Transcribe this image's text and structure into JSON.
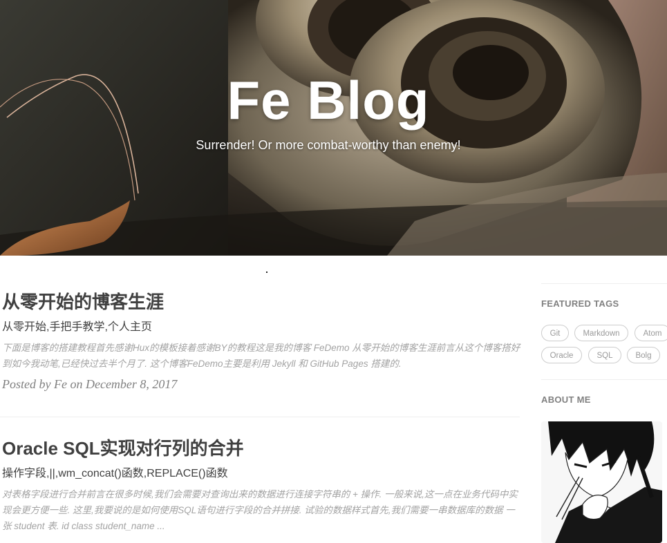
{
  "hero": {
    "title": "Fe Blog",
    "subtitle": "Surrender! Or more combat-worthy than enemy!"
  },
  "posts": [
    {
      "title": "从零开始的博客生涯",
      "subtitle": "从零开始,手把手教学,个人主页",
      "excerpt": "下面是博客的搭建教程首先感谢Hux的模板接着感谢BY的教程这是我的博客 FeDemo 从零开始的博客生涯前言从这个博客搭好到如今我动笔,已经快过去半个月了. 这个博客FeDemo主要是利用 Jekyll 和 GitHub Pages 搭建的.",
      "meta": "Posted by Fe on December 8, 2017"
    },
    {
      "title": "Oracle SQL实现对行列的合并",
      "subtitle": "操作字段,||,wm_concat()函数,REPLACE()函数",
      "excerpt": "对表格字段进行合并前言在很多时候,我们会需要对查询出来的数据进行连接字符串的 + 操作. 一般来说,这一点在业务代码中实现会更方便一些. 这里,我要说的是如何使用SQL语句进行字段的合并拼接. 试验的数据样式首先,我们需要一串数据库的数据 一张 student 表. id class student_name ..."
    }
  ],
  "sidebar": {
    "featured_tags_heading": "FEATURED TAGS",
    "tags": [
      "Git",
      "Markdown",
      "Atom",
      "Oracle",
      "SQL",
      "Bolg"
    ],
    "about_heading": "ABOUT ME"
  },
  "colors": {
    "heading": "#404040",
    "excerpt": "#a3a3a3",
    "meta": "#808080",
    "tag_border": "#cccccc",
    "divider": "#eeeeee"
  }
}
